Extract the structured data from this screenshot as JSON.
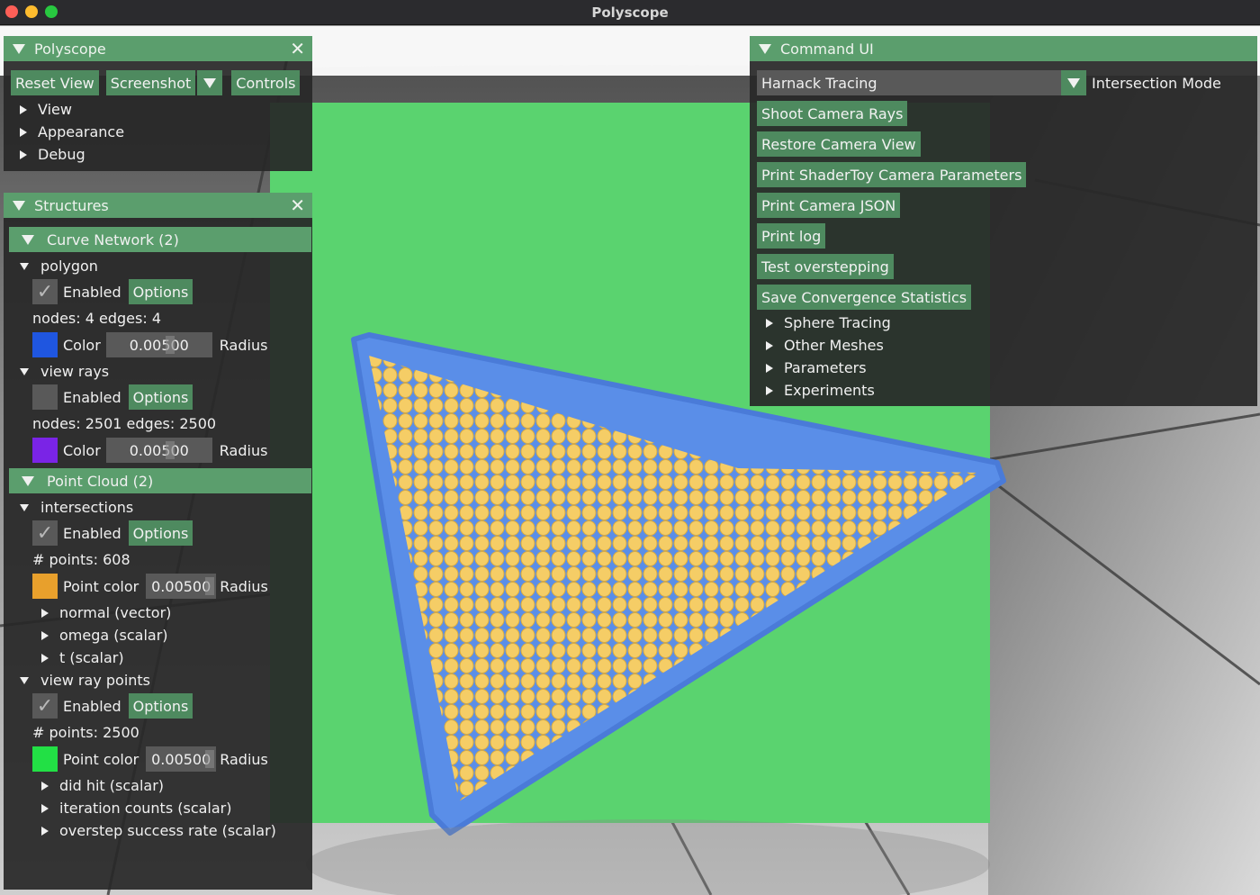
{
  "window": {
    "title": "Polyscope"
  },
  "polyscope_panel": {
    "title": "Polyscope",
    "buttons": {
      "reset_view": "Reset View",
      "screenshot": "Screenshot",
      "controls": "Controls"
    },
    "sections": [
      "View",
      "Appearance",
      "Debug"
    ]
  },
  "structures_panel": {
    "title": "Structures",
    "curve_network": {
      "header": "Curve Network (2)",
      "polygon": {
        "name": "polygon",
        "enabled": "Enabled",
        "options": "Options",
        "stats": "nodes: 4  edges: 4",
        "color_label": "Color",
        "radius_value": "0.00500",
        "radius_label": "Radius",
        "color": "#1f56e0"
      },
      "view_rays": {
        "name": "view rays",
        "enabled": "Enabled",
        "options": "Options",
        "stats": "nodes: 2501  edges: 2500",
        "color_label": "Color",
        "radius_value": "0.00500",
        "radius_label": "Radius",
        "color": "#7a24e6"
      }
    },
    "point_cloud": {
      "header": "Point Cloud (2)",
      "intersections": {
        "name": "intersections",
        "enabled": "Enabled",
        "options": "Options",
        "stats": "# points: 608",
        "color_label": "Point color",
        "radius_value": "0.00500",
        "radius_label": "Radius",
        "color": "#e8a02c",
        "quantities": [
          "normal (vector)",
          "omega (scalar)",
          "t (scalar)"
        ]
      },
      "view_ray_points": {
        "name": "view ray points",
        "enabled": "Enabled",
        "options": "Options",
        "stats": "# points: 2500",
        "color_label": "Point color",
        "radius_value": "0.00500",
        "radius_label": "Radius",
        "color": "#22e045",
        "quantities": [
          "did hit (scalar)",
          "iteration counts (scalar)",
          "overstep success rate (scalar)"
        ]
      }
    }
  },
  "command_panel": {
    "title": "Command UI",
    "mode_value": "Harnack Tracing",
    "mode_label": "Intersection Mode",
    "buttons": [
      "Shoot Camera Rays",
      "Restore Camera View",
      "Print ShaderToy Camera Parameters",
      "Print Camera JSON",
      "Print log",
      "Test overstepping",
      "Save Convergence Statistics"
    ],
    "sections": [
      "Sphere Tracing",
      "Other Meshes",
      "Parameters",
      "Experiments"
    ]
  },
  "scene": {
    "plane_color": "#5ad36f",
    "curve_color": "#5a8ee8",
    "points_color": "#f5cd66"
  }
}
